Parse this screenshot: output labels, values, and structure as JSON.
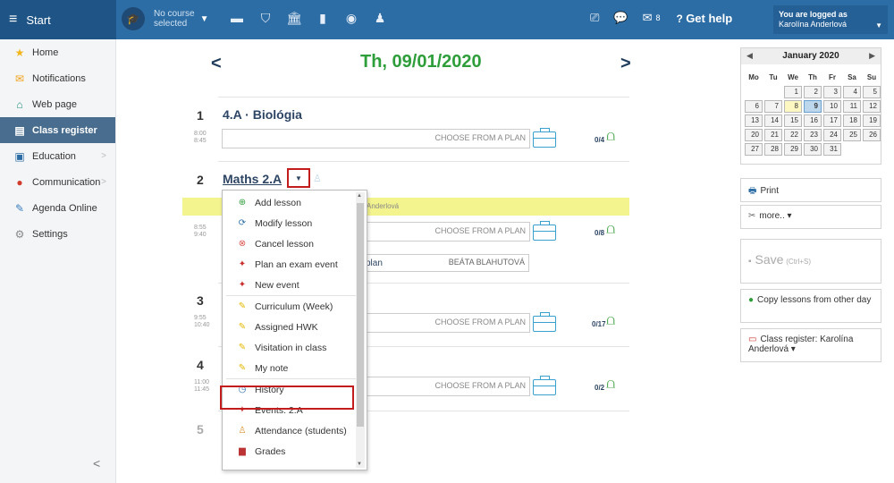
{
  "topbar": {
    "start_label": "Start",
    "course_line1": "No course",
    "course_line2": "selected",
    "mail_count": "8",
    "help_label": "Get help",
    "logged_line1": "You are logged as",
    "logged_line2": "Karolína Anderlová"
  },
  "sidebar": {
    "items": [
      {
        "label": "Home"
      },
      {
        "label": "Notifications"
      },
      {
        "label": "Web page"
      },
      {
        "label": "Class register"
      },
      {
        "label": "Education"
      },
      {
        "label": "Communication"
      },
      {
        "label": "Agenda Online"
      },
      {
        "label": "Settings"
      }
    ],
    "collapse_glyph": "<"
  },
  "main": {
    "date": "Th, 09/01/2020",
    "prev_glyph": "<",
    "next_glyph": ">",
    "choose_label": "CHOOSE FROM A PLAN",
    "lessons": [
      {
        "num": "1",
        "start": "8:00",
        "end": "8:45",
        "title": "4.A · Biológia",
        "count": "0/4"
      },
      {
        "num": "2",
        "start": "8:55",
        "end": "9:40",
        "title": "Maths 2.A",
        "count": "0/8",
        "teacher_bar": "Anderlová",
        "plan_label": "plan",
        "plan_teacher": "BEÁTA BLAHUTOVÁ"
      },
      {
        "num": "3",
        "start": "9:55",
        "end": "10:40",
        "count": "0/17"
      },
      {
        "num": "4",
        "start": "11:00",
        "end": "11:45",
        "count": "0/2"
      },
      {
        "num": "5"
      }
    ]
  },
  "dropdown": {
    "items": [
      "Add lesson",
      "Modify lesson",
      "Cancel lesson",
      "Plan an exam event",
      "New event",
      "Curriculum (Week)",
      "Assigned HWK",
      "Visitation in class",
      "My note",
      "History",
      "Events: 2.A",
      "Attendance (students)",
      "Grades"
    ]
  },
  "calendar": {
    "month": "January 2020",
    "dows": [
      "Mo",
      "Tu",
      "We",
      "Th",
      "Fr",
      "Sa",
      "Su"
    ],
    "weeks": [
      [
        "",
        "",
        "1",
        "2",
        "3",
        "4",
        "5"
      ],
      [
        "6",
        "7",
        "8",
        "9",
        "10",
        "11",
        "12"
      ],
      [
        "13",
        "14",
        "15",
        "16",
        "17",
        "18",
        "19"
      ],
      [
        "20",
        "21",
        "22",
        "23",
        "24",
        "25",
        "26"
      ],
      [
        "27",
        "28",
        "29",
        "30",
        "31",
        "",
        ""
      ]
    ]
  },
  "right": {
    "print": "Print",
    "more": "more.. ▾",
    "save": "Save",
    "save_shortcut": "(Ctrl+S)",
    "copy": "Copy lessons from other day",
    "class_register": "Class register: Karolína Anderlová ▾"
  }
}
